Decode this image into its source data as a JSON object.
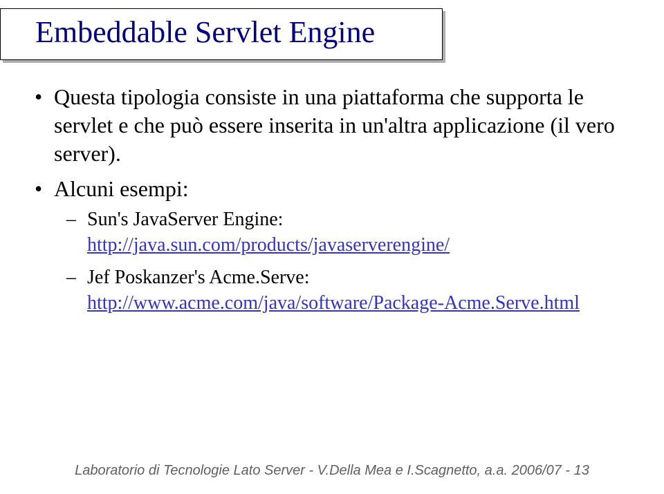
{
  "title": "Embeddable Servlet Engine",
  "bullets": {
    "b1": "Questa tipologia consiste in una piattaforma che supporta le servlet e che può essere inserita in un'altra applicazione (il vero server).",
    "b2": "Alcuni esempi:",
    "sub1_text": "Sun's JavaServer Engine: ",
    "sub1_link": "http://java.sun.com/products/javaserverengine/",
    "sub2_text": "Jef Poskanzer's Acme.Serve: ",
    "sub2_link": "http://www.acme.com/java/software/Package-Acme.Serve.html"
  },
  "footer": "Laboratorio di Tecnologie Lato Server - V.Della Mea e I.Scagnetto, a.a. 2006/07 - 13"
}
